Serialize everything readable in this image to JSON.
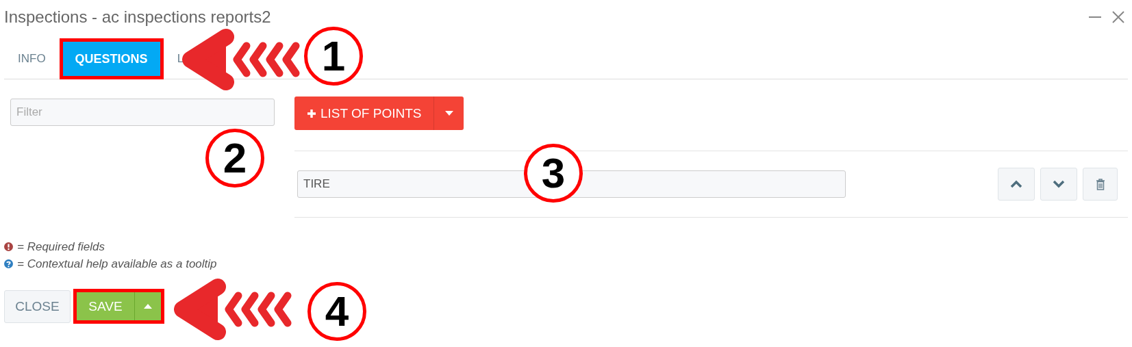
{
  "window": {
    "title": "Inspections - ac inspections reports2"
  },
  "tabs": [
    {
      "label": "INFO",
      "selected": false,
      "highlighted": false
    },
    {
      "label": "QUESTIONS",
      "selected": true,
      "highlighted": true
    },
    {
      "label": "L",
      "selected": false,
      "highlighted": false
    }
  ],
  "filter": {
    "placeholder": "Filter"
  },
  "add_button": {
    "label": "LIST OF POINTS"
  },
  "points": [
    {
      "value": "TIRE"
    }
  ],
  "legend": [
    {
      "kind": "required",
      "text": "= Required fields"
    },
    {
      "kind": "help",
      "text": "= Contextual help available as a tooltip"
    }
  ],
  "footer": {
    "close": "CLOSE",
    "save": "SAVE",
    "save_highlighted": true
  },
  "annotations": [
    {
      "number": "1",
      "kind": "arrow"
    },
    {
      "number": "2",
      "kind": "circle"
    },
    {
      "number": "3",
      "kind": "circle"
    },
    {
      "number": "4",
      "kind": "arrow"
    }
  ]
}
